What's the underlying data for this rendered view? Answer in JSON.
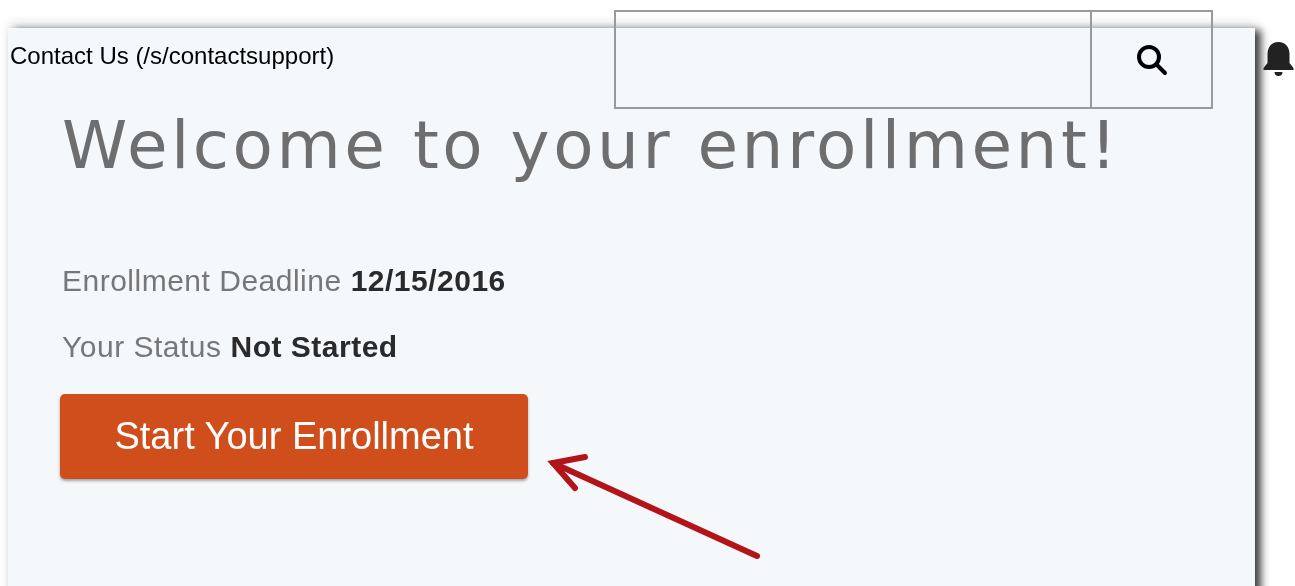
{
  "header": {
    "contact_link": "Contact Us (/s/contactsupport)"
  },
  "heading": "Welcome to your enrollment!",
  "details": [
    {
      "label": "Enrollment Deadline",
      "value": "12/15/2016"
    },
    {
      "label": "Your Status",
      "value": "Not Started"
    }
  ],
  "start_button": "Start Your Enrollment"
}
